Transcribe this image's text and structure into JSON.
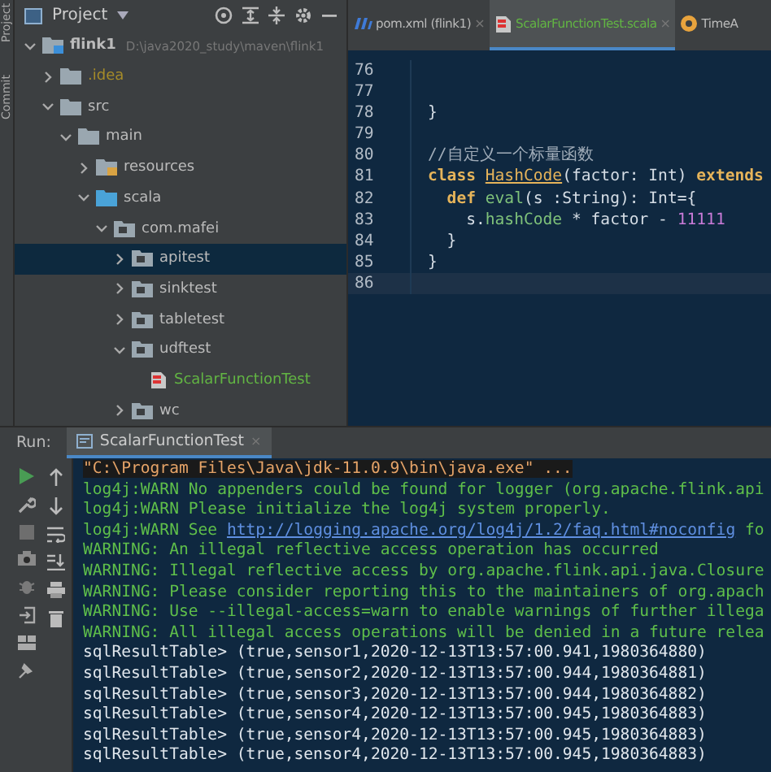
{
  "tool_strip": {
    "labels": [
      "Project",
      "Commit"
    ]
  },
  "project_panel": {
    "title": "Project",
    "tree": [
      {
        "label": "flink1",
        "path": "D:\\java2020_study\\maven\\flink1",
        "kind": "module",
        "color": "#bbbbbb",
        "expanded": true,
        "selected": false,
        "children": [
          {
            "label": ".idea",
            "kind": "folder",
            "color": "#a58b29",
            "expanded": false,
            "selected": false
          },
          {
            "label": "src",
            "kind": "folder",
            "color": "#bbbbbb",
            "expanded": true,
            "selected": false,
            "children": [
              {
                "label": "main",
                "kind": "folder",
                "color": "#bbbbbb",
                "expanded": true,
                "selected": false,
                "children": [
                  {
                    "label": "resources",
                    "kind": "resources",
                    "color": "#bbbbbb",
                    "expanded": false,
                    "selected": false
                  },
                  {
                    "label": "scala",
                    "kind": "source",
                    "color": "#bbbbbb",
                    "expanded": true,
                    "selected": false,
                    "children": [
                      {
                        "label": "com.mafei",
                        "kind": "package",
                        "color": "#bbbbbb",
                        "expanded": true,
                        "selected": false,
                        "children": [
                          {
                            "label": "apitest",
                            "kind": "package",
                            "color": "#bbbbbb",
                            "expanded": false,
                            "selected": true
                          },
                          {
                            "label": "sinktest",
                            "kind": "package",
                            "color": "#bbbbbb",
                            "expanded": false,
                            "selected": false
                          },
                          {
                            "label": "tabletest",
                            "kind": "package",
                            "color": "#bbbbbb",
                            "expanded": false,
                            "selected": false
                          },
                          {
                            "label": "udftest",
                            "kind": "package",
                            "color": "#bbbbbb",
                            "expanded": true,
                            "selected": false,
                            "children": [
                              {
                                "label": "ScalarFunctionTest",
                                "kind": "file",
                                "color": "#62b543",
                                "selected": false
                              }
                            ]
                          },
                          {
                            "label": "wc",
                            "kind": "package",
                            "color": "#bbbbbb",
                            "expanded": false,
                            "selected": false
                          }
                        ]
                      }
                    ]
                  }
                ]
              }
            ]
          }
        ]
      }
    ]
  },
  "editor": {
    "tabs": [
      {
        "label": "pom.xml (flink1)",
        "kind": "maven",
        "color": "#bbbbbb",
        "selected": false,
        "close": "×"
      },
      {
        "label": "ScalarFunctionTest.scala",
        "kind": "scala",
        "color": "#62b543",
        "selected": true,
        "close": "×"
      },
      {
        "label": "TimeA",
        "kind": "object",
        "color": "#bbbbbb",
        "selected": false
      }
    ],
    "lines": [
      {
        "number": "76",
        "current": false
      },
      {
        "number": "77",
        "current": false
      },
      {
        "number": "78",
        "current": false,
        "tokens": [
          {
            "kind": "plain",
            "text": "}"
          }
        ]
      },
      {
        "number": "79",
        "current": false
      },
      {
        "number": "80",
        "current": false,
        "tokens": [
          {
            "kind": "comment",
            "text": "//自定义一个标量函数"
          }
        ]
      },
      {
        "number": "81",
        "current": false,
        "tokens": [
          {
            "kind": "keyword",
            "text": "class "
          },
          {
            "kind": "type",
            "text": "HashCode"
          },
          {
            "kind": "plain",
            "text": "(factor: Int) "
          },
          {
            "kind": "keyword",
            "text": "extends"
          }
        ]
      },
      {
        "number": "82",
        "current": false,
        "tokens": [
          {
            "kind": "keyword",
            "text": "  def "
          },
          {
            "kind": "method",
            "text": "eval"
          },
          {
            "kind": "plain",
            "text": "(s :String): Int={"
          }
        ]
      },
      {
        "number": "83",
        "current": false,
        "tokens": [
          {
            "kind": "plain",
            "text": "    s."
          },
          {
            "kind": "method",
            "text": "hashCode"
          },
          {
            "kind": "plain",
            "text": " * factor - "
          },
          {
            "kind": "number",
            "text": "11111"
          }
        ]
      },
      {
        "number": "84",
        "current": false,
        "tokens": [
          {
            "kind": "plain",
            "text": "  }"
          }
        ]
      },
      {
        "number": "85",
        "current": false,
        "tokens": [
          {
            "kind": "plain",
            "text": "}"
          }
        ]
      },
      {
        "number": "86",
        "current": true
      }
    ]
  },
  "run_panel": {
    "label": "Run:",
    "tab": {
      "label": "ScalarFunctionTest",
      "close": "×"
    },
    "console": [
      {
        "segments": [
          {
            "kind": "command",
            "text": "\"C:\\Program Files\\Java\\jdk-11.0.9\\bin\\java.exe\" ..."
          }
        ]
      },
      {
        "segments": [
          {
            "kind": "warn",
            "text": "log4j:WARN No appenders could be found for logger (org.apache.flink.api"
          }
        ]
      },
      {
        "segments": [
          {
            "kind": "warn",
            "text": "log4j:WARN Please initialize the log4j system properly."
          }
        ]
      },
      {
        "segments": [
          {
            "kind": "warn",
            "text": "log4j:WARN See "
          },
          {
            "kind": "link",
            "text": "http://logging.apache.org/log4j/1.2/faq.html#noconfig"
          },
          {
            "kind": "warn",
            "text": " fo"
          }
        ]
      },
      {
        "segments": [
          {
            "kind": "warn",
            "text": "WARNING: An illegal reflective access operation has occurred"
          }
        ]
      },
      {
        "segments": [
          {
            "kind": "warn",
            "text": "WARNING: Illegal reflective access by org.apache.flink.api.java.Closure"
          }
        ]
      },
      {
        "segments": [
          {
            "kind": "warn",
            "text": "WARNING: Please consider reporting this to the maintainers of org.apach"
          }
        ]
      },
      {
        "segments": [
          {
            "kind": "warn",
            "text": "WARNING: Use --illegal-access=warn to enable warnings of further illega"
          }
        ]
      },
      {
        "segments": [
          {
            "kind": "warn",
            "text": "WARNING: All illegal access operations will be denied in a future relea"
          }
        ]
      },
      {
        "segments": [
          {
            "kind": "output",
            "text": "sqlResultTable> (true,sensor1,2020-12-13T13:57:00.941,1980364880)"
          }
        ]
      },
      {
        "segments": [
          {
            "kind": "output",
            "text": "sqlResultTable> (true,sensor2,2020-12-13T13:57:00.944,1980364881)"
          }
        ]
      },
      {
        "segments": [
          {
            "kind": "output",
            "text": "sqlResultTable> (true,sensor3,2020-12-13T13:57:00.944,1980364882)"
          }
        ]
      },
      {
        "segments": [
          {
            "kind": "output",
            "text": "sqlResultTable> (true,sensor4,2020-12-13T13:57:00.945,1980364883)"
          }
        ]
      },
      {
        "segments": [
          {
            "kind": "output",
            "text": "sqlResultTable> (true,sensor4,2020-12-13T13:57:00.945,1980364883)"
          }
        ]
      },
      {
        "segments": [
          {
            "kind": "output",
            "text": "sqlResultTable> (true,sensor4,2020-12-13T13:57:00.945,1980364883)"
          }
        ]
      }
    ]
  }
}
